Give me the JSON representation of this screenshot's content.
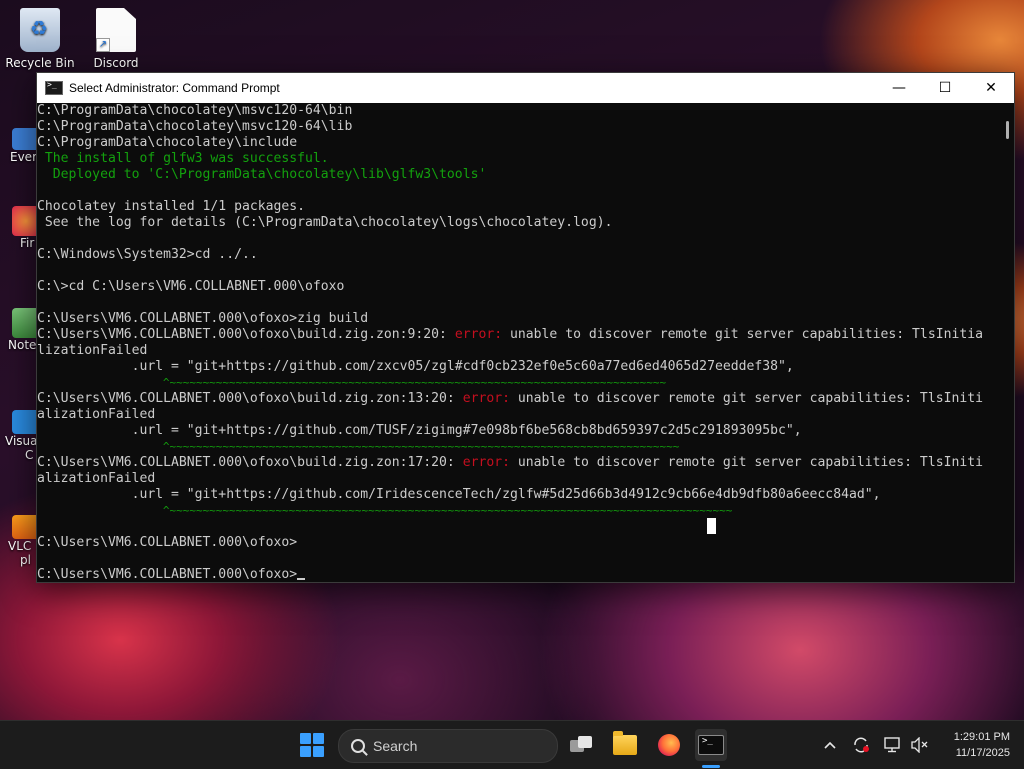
{
  "desktop": {
    "icons": [
      {
        "label": "Recycle Bin"
      },
      {
        "label": "Discord"
      }
    ],
    "partial_labels": [
      "Every",
      "Fir",
      "Note",
      "Visual",
      "C",
      "VLC",
      "pl"
    ]
  },
  "window": {
    "title": "Select Administrator: Command Prompt",
    "controls": {
      "minimize": "—",
      "maximize": "☐",
      "close": "✕"
    }
  },
  "console": {
    "lines": [
      {
        "segments": [
          {
            "text": "C:\\ProgramData\\chocolatey\\msvc120-64\\bin",
            "color": "default"
          }
        ]
      },
      {
        "segments": [
          {
            "text": "C:\\ProgramData\\chocolatey\\msvc120-64\\lib",
            "color": "default"
          }
        ]
      },
      {
        "segments": [
          {
            "text": "C:\\ProgramData\\chocolatey\\include",
            "color": "default"
          }
        ]
      },
      {
        "segments": [
          {
            "text": " The install of glfw3 was successful.",
            "color": "green"
          }
        ]
      },
      {
        "segments": [
          {
            "text": "  Deployed to 'C:\\ProgramData\\chocolatey\\lib\\glfw3\\tools'",
            "color": "green"
          }
        ]
      },
      {
        "segments": [
          {
            "text": "",
            "color": "default"
          }
        ]
      },
      {
        "segments": [
          {
            "text": "Chocolatey installed 1/1 packages.",
            "color": "default"
          }
        ]
      },
      {
        "segments": [
          {
            "text": " See the log for details (C:\\ProgramData\\chocolatey\\logs\\chocolatey.log).",
            "color": "default"
          }
        ]
      },
      {
        "segments": [
          {
            "text": "",
            "color": "default"
          }
        ]
      },
      {
        "segments": [
          {
            "text": "C:\\Windows\\System32>cd ../..",
            "color": "default"
          }
        ]
      },
      {
        "segments": [
          {
            "text": "",
            "color": "default"
          }
        ]
      },
      {
        "segments": [
          {
            "text": "C:\\>cd C:\\Users\\VM6.COLLABNET.000\\ofoxo",
            "color": "default"
          }
        ]
      },
      {
        "segments": [
          {
            "text": "",
            "color": "default"
          }
        ]
      },
      {
        "segments": [
          {
            "text": "C:\\Users\\VM6.COLLABNET.000\\ofoxo>zig build",
            "color": "default"
          }
        ]
      },
      {
        "segments": [
          {
            "text": "C:\\Users\\VM6.COLLABNET.000\\ofoxo\\build.zig.zon:9:20: ",
            "color": "default"
          },
          {
            "text": "error:",
            "color": "red"
          },
          {
            "text": " unable to discover remote git server capabilities: TlsInitia",
            "color": "default"
          }
        ]
      },
      {
        "segments": [
          {
            "text": "lizationFailed",
            "color": "default"
          }
        ]
      },
      {
        "segments": [
          {
            "text": "            .url = \"git+https://github.com/zxcv05/zgl#cdf0cb232ef0e5c60a77ed6ed4065d27eeddef38\",",
            "color": "default"
          }
        ]
      },
      {
        "segments": [
          {
            "text": "                   ^~~~~~~~~~~~~~~~~~~~~~~~~~~~~~~~~~~~~~~~~~~~~~~~~~~~~~~~~~~~~~~~~~~~~~~~~~~~",
            "color": "tilde"
          }
        ]
      },
      {
        "segments": [
          {
            "text": "C:\\Users\\VM6.COLLABNET.000\\ofoxo\\build.zig.zon:13:20: ",
            "color": "default"
          },
          {
            "text": "error:",
            "color": "red"
          },
          {
            "text": " unable to discover remote git server capabilities: TlsIniti",
            "color": "default"
          }
        ]
      },
      {
        "segments": [
          {
            "text": "alizationFailed",
            "color": "default"
          }
        ]
      },
      {
        "segments": [
          {
            "text": "            .url = \"git+https://github.com/TUSF/zigimg#7e098bf6be568cb8bd659397c2d5c291893095bc\",",
            "color": "default"
          }
        ]
      },
      {
        "segments": [
          {
            "text": "                   ^~~~~~~~~~~~~~~~~~~~~~~~~~~~~~~~~~~~~~~~~~~~~~~~~~~~~~~~~~~~~~~~~~~~~~~~~~~~~~",
            "color": "tilde"
          }
        ]
      },
      {
        "segments": [
          {
            "text": "C:\\Users\\VM6.COLLABNET.000\\ofoxo\\build.zig.zon:17:20: ",
            "color": "default"
          },
          {
            "text": "error:",
            "color": "red"
          },
          {
            "text": " unable to discover remote git server capabilities: TlsIniti",
            "color": "default"
          }
        ]
      },
      {
        "segments": [
          {
            "text": "alizationFailed",
            "color": "default"
          }
        ]
      },
      {
        "segments": [
          {
            "text": "            .url = \"git+https://github.com/IridescenceTech/zglfw#5d25d66b3d4912c9cb66e4db9dfb80a6eecc84ad\",",
            "color": "default"
          }
        ]
      },
      {
        "segments": [
          {
            "text": "                   ^~~~~~~~~~~~~~~~~~~~~~~~~~~~~~~~~~~~~~~~~~~~~~~~~~~~~~~~~~~~~~~~~~~~~~~~~~~~~~~~~~~~~~",
            "color": "tilde"
          }
        ]
      },
      {
        "segments": [
          {
            "text": "",
            "color": "default"
          }
        ]
      },
      {
        "segments": [
          {
            "text": "C:\\Users\\VM6.COLLABNET.000\\ofoxo>",
            "color": "default"
          }
        ]
      },
      {
        "segments": [
          {
            "text": "",
            "color": "default"
          }
        ]
      },
      {
        "segments": [
          {
            "text": "C:\\Users\\VM6.COLLABNET.000\\ofoxo>",
            "color": "default"
          }
        ],
        "cursor": true
      }
    ]
  },
  "taskbar": {
    "search_label": "Search",
    "pinned": [
      "start-icon",
      "task-view-icon",
      "file-explorer-icon",
      "firefox-icon",
      "terminal-icon"
    ],
    "tray_icons": [
      "chevron-up-icon",
      "sync-icon",
      "display-icon",
      "volume-muted-icon"
    ],
    "time": "1:29:01 PM",
    "date": "11/17/2025"
  },
  "colors": {
    "console_bg": "#0c0c0c",
    "console_text": "#cccccc",
    "green": "#13a10e",
    "red": "#c50f1f",
    "accent": "#3aa0ff"
  }
}
